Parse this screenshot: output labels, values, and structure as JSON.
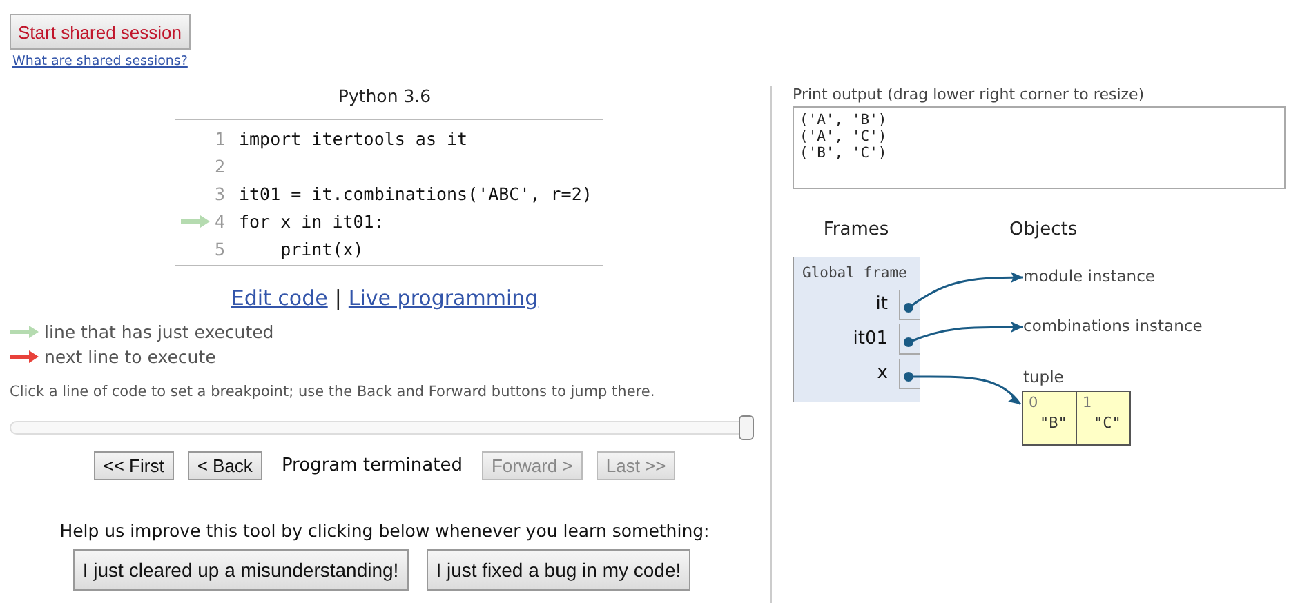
{
  "session": {
    "button": "Start shared session",
    "link": "What are shared sessions?"
  },
  "editor": {
    "language": "Python 3.6",
    "lines": [
      {
        "number": "1",
        "code": "import itertools as it",
        "just_executed": false
      },
      {
        "number": "2",
        "just_executed": false
      },
      {
        "number": "3",
        "code": "it01 = it.combinations('ABC', r=2)",
        "just_executed": false
      },
      {
        "number": "4",
        "code": "for x in it01:",
        "just_executed": true
      },
      {
        "number": "5",
        "code": "    print(x)",
        "just_executed": false
      }
    ]
  },
  "edit_links": {
    "edit": "Edit code",
    "separator": "|",
    "live": "Live programming"
  },
  "legend": [
    {
      "label": "line that has just executed",
      "color": "#b5dbb0"
    },
    {
      "label": "next line to execute",
      "color": "#e8413a"
    }
  ],
  "hint": "Click a line of code to set a breakpoint; use the Back and Forward buttons to jump there.",
  "step_slider": {
    "level": 1
  },
  "nav": [
    {
      "kind": "button",
      "label": "<< First",
      "disabled": false
    },
    {
      "kind": "button",
      "label": "< Back",
      "disabled": false
    },
    {
      "kind": "status",
      "label": "Program terminated"
    },
    {
      "kind": "button",
      "label": "Forward >",
      "disabled": true
    },
    {
      "kind": "button",
      "label": "Last >>",
      "disabled": true
    }
  ],
  "feedback": {
    "prompt": "Help us improve this tool by clicking below whenever you learn something:",
    "buttons": [
      "I just cleared up a misunderstanding!",
      "I just fixed a bug in my code!"
    ]
  },
  "print_output": {
    "label": "Print output (drag lower right corner to resize)",
    "lines": [
      "('A', 'B')",
      "('A', 'C')",
      "('B', 'C')"
    ]
  },
  "frames": {
    "heading": "Frames",
    "frame_title": "Global frame",
    "variables": [
      {
        "name": "it"
      },
      {
        "name": "it01"
      },
      {
        "name": "x"
      }
    ]
  },
  "objects": {
    "heading": "Objects",
    "items": [
      {
        "kind": "instance",
        "label": "module instance"
      },
      {
        "kind": "instance",
        "label": "combinations instance"
      },
      {
        "kind": "tuple",
        "label": "tuple",
        "cells": [
          {
            "index": "0",
            "value": "\"B\""
          },
          {
            "index": "1",
            "value": "\"C\""
          }
        ]
      }
    ]
  }
}
